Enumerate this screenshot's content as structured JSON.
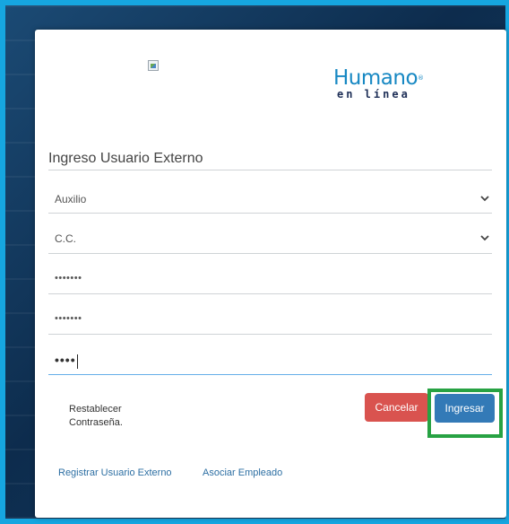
{
  "form": {
    "title": "Ingreso Usuario Externo",
    "selects": [
      {
        "value": "Auxilio"
      },
      {
        "value": "C.C."
      }
    ],
    "inputs": [
      {
        "value": "•••••••"
      },
      {
        "value": "•••••••"
      },
      {
        "value": "••••"
      }
    ],
    "reset_link_line1": "Restablecer",
    "reset_link_line2": "Contraseña.",
    "cancel_label": "Cancelar",
    "login_label": "Ingresar",
    "register_link": "Registrar Usuario Externo",
    "associate_link": "Asociar Empleado"
  },
  "logo": {
    "main": "Humano",
    "reg": "®",
    "sub": "en línea"
  },
  "colors": {
    "frame": "#16a6e0",
    "cancel": "#d9534f",
    "login": "#337ab7",
    "highlight": "#27a243",
    "link": "#2d6fa3"
  }
}
